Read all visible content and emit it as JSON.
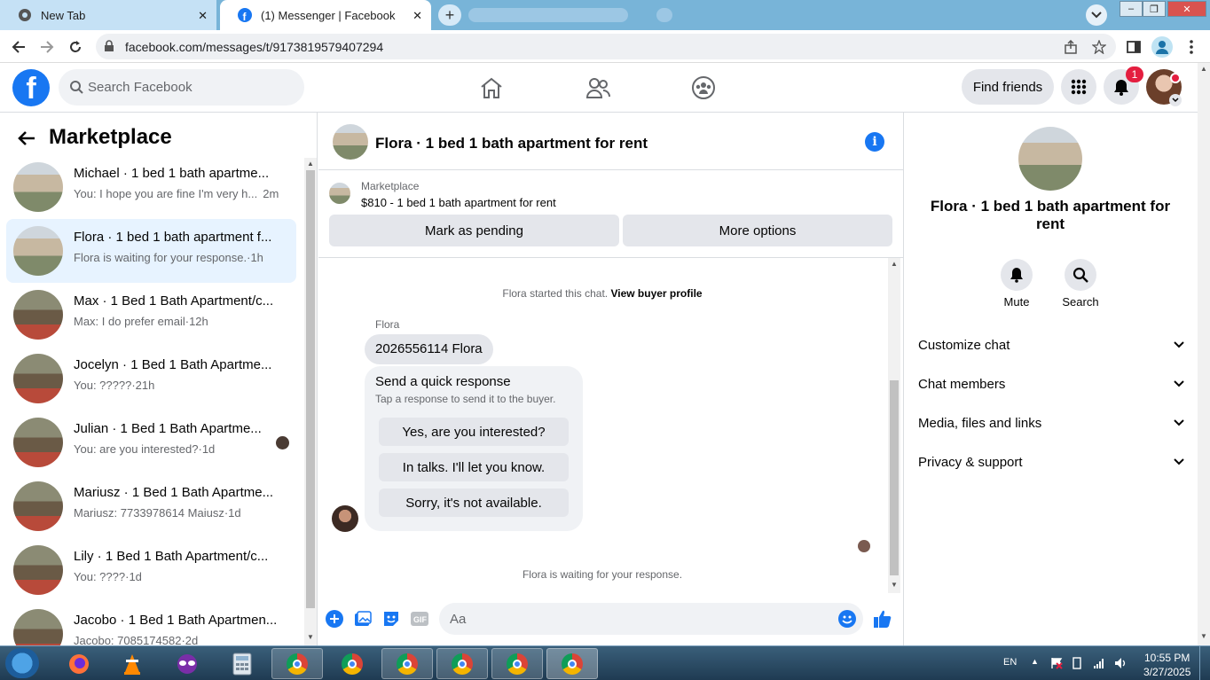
{
  "browser": {
    "tabs": [
      {
        "title": "New Tab",
        "close": "✕"
      },
      {
        "title": "(1) Messenger | Facebook",
        "close": "✕"
      }
    ],
    "new_tab": "+",
    "url": "facebook.com/messages/t/9173819579407294",
    "window_controls": [
      "–",
      "❐",
      "✕"
    ]
  },
  "facebook": {
    "search_placeholder": "Search Facebook",
    "find_friends": "Find friends",
    "notification_count": "1",
    "nav_icons": [
      "home-icon",
      "friends-icon",
      "groups-icon"
    ]
  },
  "marketplace": {
    "title": "Marketplace",
    "conversations": [
      {
        "name": "Michael · 1 bed 1 bath apartme...",
        "preview": "You: I hope you are fine I'm very h...",
        "time": "2m"
      },
      {
        "name": "Flora · 1 bed 1 bath apartment f...",
        "preview": "Flora is waiting for your response.",
        "time": "1h"
      },
      {
        "name": "Max · 1 Bed 1 Bath Apartment/c...",
        "preview": "Max: I do prefer email",
        "time": "12h"
      },
      {
        "name": "Jocelyn · 1 Bed 1 Bath Apartme...",
        "preview": "You: ?????",
        "time": "21h"
      },
      {
        "name": "Julian · 1 Bed 1 Bath Apartme...",
        "preview": "You: are you interested?",
        "time": "1d"
      },
      {
        "name": "Mariusz · 1 Bed 1 Bath Apartme...",
        "preview": "Mariusz: 7733978614 Maiusz",
        "time": "1d"
      },
      {
        "name": "Lily · 1 Bed 1 Bath Apartment/c...",
        "preview": "You: ????",
        "time": "1d"
      },
      {
        "name": "Jacobo · 1 Bed 1 Bath Apartmen...",
        "preview": "Jacobo: 7085174582",
        "time": "2d"
      }
    ]
  },
  "chat": {
    "title": "Flora · 1 bed 1 bath apartment for rent",
    "listing_source": "Marketplace",
    "listing_price": "$810 - 1 bed 1 bath apartment for rent",
    "mark_pending": "Mark as pending",
    "more_options": "More options",
    "started_text": "Flora started this chat.",
    "view_buyer": "View buyer profile",
    "sender": "Flora",
    "message": "2026556114 Flora",
    "quick_title": "Send a quick response",
    "quick_sub": "Tap a response to send it to the buyer.",
    "quick_responses": [
      "Yes, are you interested?",
      "In talks. I'll let you know.",
      "Sorry, it's not available."
    ],
    "waiting": "Flora is waiting for your response.",
    "composer_placeholder": "Aa"
  },
  "details": {
    "name": "Flora · 1 bed 1 bath apartment for rent",
    "mute": "Mute",
    "search": "Search",
    "sections": [
      "Customize chat",
      "Chat members",
      "Media, files and links",
      "Privacy & support"
    ]
  },
  "taskbar": {
    "lang": "EN",
    "time": "10:55 PM",
    "date": "3/27/2025"
  },
  "colors": {
    "accent": "#1877f2",
    "active_row": "#e7f3ff",
    "badge": "#e41e3f"
  }
}
